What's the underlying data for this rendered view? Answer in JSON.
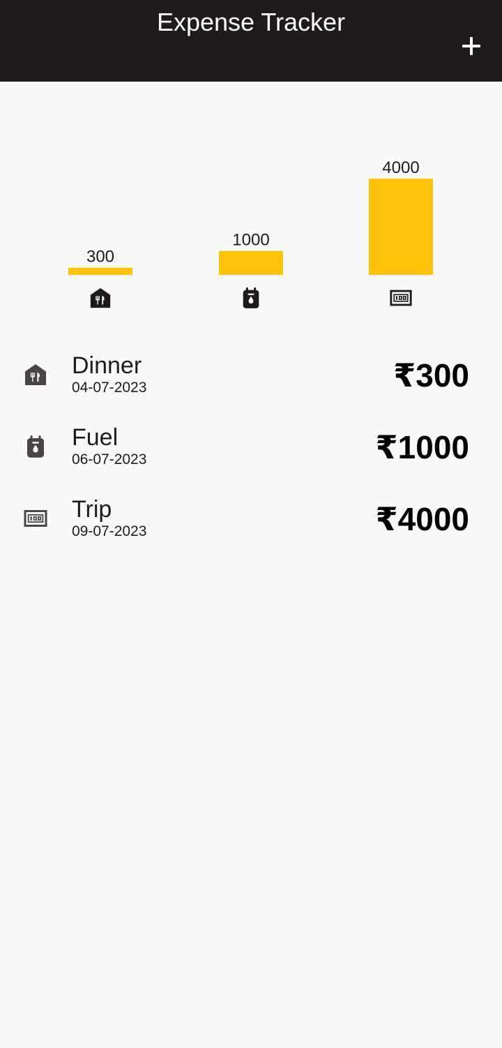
{
  "app_bar": {
    "title": "Expense Tracker",
    "add_icon": "plus-icon"
  },
  "colors": {
    "app_bar_bg": "#1f1b1c",
    "background": "#f9f9f9",
    "bar_fill": "#ffc20a",
    "icon": "#4a4446"
  },
  "chart_data": {
    "type": "bar",
    "categories": [
      "food",
      "fuel",
      "travel"
    ],
    "category_icons": [
      "restaurant-icon",
      "fuel-can-icon",
      "currency-note-icon"
    ],
    "values": [
      300,
      1000,
      4000
    ],
    "data_labels": [
      "300",
      "1000",
      "4000"
    ],
    "ylim": [
      0,
      4000
    ],
    "grid": false,
    "title": "",
    "xlabel": "",
    "ylabel": ""
  },
  "expenses": [
    {
      "title": "Dinner",
      "date": "04-07-2023",
      "amount": "₹300",
      "icon": "restaurant-icon"
    },
    {
      "title": "Fuel",
      "date": "06-07-2023",
      "amount": "₹1000",
      "icon": "fuel-can-icon"
    },
    {
      "title": "Trip",
      "date": "09-07-2023",
      "amount": "₹4000",
      "icon": "currency-note-icon"
    }
  ]
}
